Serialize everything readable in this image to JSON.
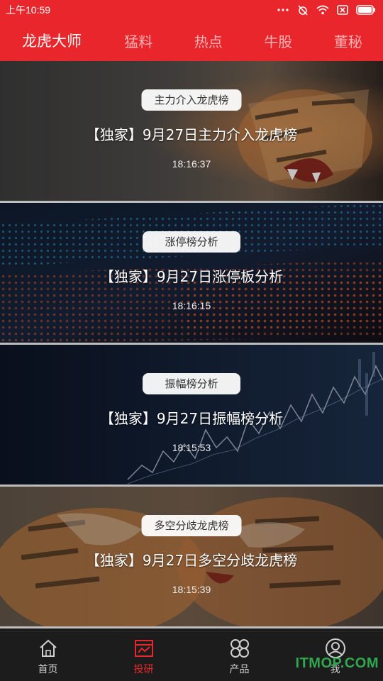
{
  "status_bar": {
    "time": "上午10:59",
    "icons": [
      "more-dots-icon",
      "alarm-off-icon",
      "wifi-icon",
      "sim-off-icon",
      "battery-icon"
    ]
  },
  "header": {
    "brand": "龙虎大师",
    "tabs": [
      "猛料",
      "热点",
      "牛股",
      "董秘"
    ],
    "colors": {
      "bar": "#e8262b",
      "inactive_tab": "#f6b2b4"
    }
  },
  "feed": {
    "items": [
      {
        "tag": "主力介入龙虎榜",
        "title": "【独家】9月27日主力介入龙虎榜",
        "time": "18:16:37",
        "image": "tiger-roaring"
      },
      {
        "tag": "涨停榜分析",
        "title": "【独家】9月27日涨停板分析",
        "time": "18:16:15",
        "image": "stock-ticker-board"
      },
      {
        "tag": "振幅榜分析",
        "title": "【独家】9月27日振幅榜分析",
        "time": "18:15:53",
        "image": "stock-line-chart"
      },
      {
        "tag": "多空分歧龙虎榜",
        "title": "【独家】9月27日多空分歧龙虎榜",
        "time": "18:15:39",
        "image": "tigers-fighting"
      }
    ]
  },
  "bottom_nav": {
    "items": [
      {
        "label": "首页",
        "icon": "home-icon",
        "active": false
      },
      {
        "label": "投研",
        "icon": "research-icon",
        "active": true
      },
      {
        "label": "产品",
        "icon": "products-icon",
        "active": false
      },
      {
        "label": "我",
        "icon": "user-icon",
        "active": false
      }
    ]
  },
  "watermark": "ITMOP.COM"
}
